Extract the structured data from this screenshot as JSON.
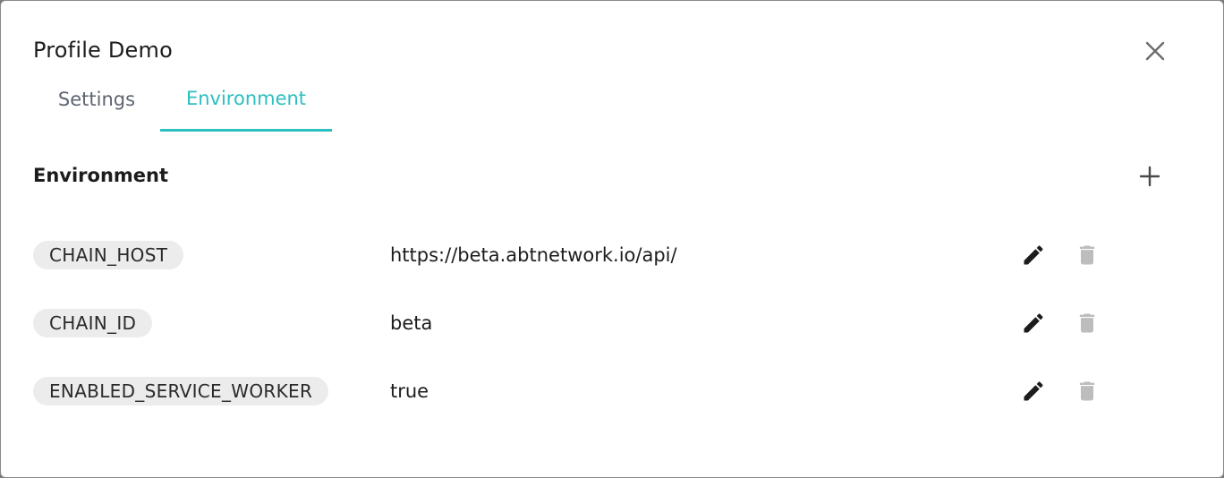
{
  "dialog": {
    "title": "Profile Demo",
    "close_icon": "close-icon"
  },
  "tabs": [
    {
      "label": "Settings",
      "active": false
    },
    {
      "label": "Environment",
      "active": true
    }
  ],
  "section": {
    "title": "Environment",
    "add_icon": "plus-icon"
  },
  "variables": [
    {
      "key": "CHAIN_HOST",
      "value": "https://beta.abtnetwork.io/api/"
    },
    {
      "key": "CHAIN_ID",
      "value": "beta"
    },
    {
      "key": "ENABLED_SERVICE_WORKER",
      "value": "true"
    }
  ],
  "colors": {
    "accent": "#2cbfbf",
    "chip_bg": "#ececec",
    "delete_disabled": "#bdbdbd",
    "edit_icon": "#1c1c1c"
  }
}
